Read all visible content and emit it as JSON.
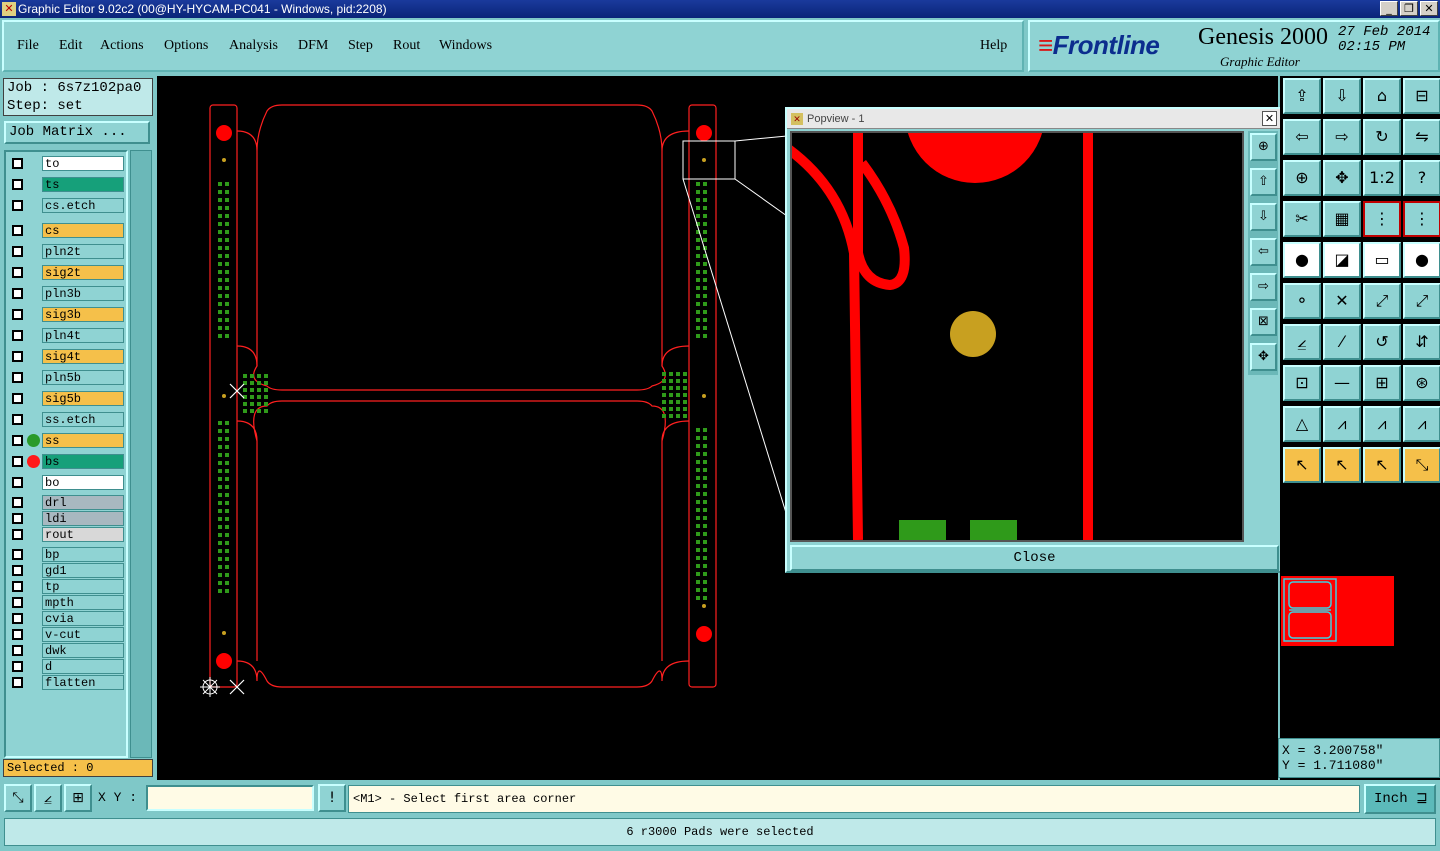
{
  "window": {
    "title": "Graphic Editor 9.02c2 (00@HY-HYCAM-PC041 - Windows, pid:2208)",
    "buttons": [
      "_",
      "❐",
      "✕"
    ]
  },
  "menu": {
    "items": [
      "File",
      "Edit",
      "Actions",
      "Options",
      "Analysis",
      "DFM",
      "Step",
      "Rout",
      "Windows"
    ],
    "help": "Help"
  },
  "brand": {
    "logo_text": "Frontline",
    "product": "Genesis 2000",
    "subtitle": "Graphic Editor",
    "date": "27 Feb 2014",
    "time": "02:15 PM"
  },
  "job": {
    "job_line": "Job : 6s7z102pa0",
    "step_line": "Step: set",
    "matrix_button": "Job Matrix ..."
  },
  "layers": [
    {
      "name": "to",
      "bg": "#ffffff",
      "dot": ""
    },
    {
      "name": "ts",
      "bg": "#16a07a",
      "dot": ""
    },
    {
      "name": "cs.etch",
      "bg": "#8fd3d3",
      "dot": ""
    },
    {
      "name": "cs",
      "bg": "#f5c04a",
      "dot": ""
    },
    {
      "name": "pln2t",
      "bg": "#8fd3d3",
      "dot": ""
    },
    {
      "name": "sig2t",
      "bg": "#f5c04a",
      "dot": ""
    },
    {
      "name": "pln3b",
      "bg": "#8fd3d3",
      "dot": ""
    },
    {
      "name": "sig3b",
      "bg": "#f5c04a",
      "dot": ""
    },
    {
      "name": "pln4t",
      "bg": "#8fd3d3",
      "dot": ""
    },
    {
      "name": "sig4t",
      "bg": "#f5c04a",
      "dot": ""
    },
    {
      "name": "pln5b",
      "bg": "#8fd3d3",
      "dot": ""
    },
    {
      "name": "sig5b",
      "bg": "#f5c04a",
      "dot": ""
    },
    {
      "name": "ss.etch",
      "bg": "#8fd3d3",
      "dot": ""
    },
    {
      "name": "ss",
      "bg": "#f5c04a",
      "dot": "#2a9a2a"
    },
    {
      "name": "bs",
      "bg": "#16a07a",
      "dot": "#ff1a1a"
    },
    {
      "name": "bo",
      "bg": "#ffffff",
      "dot": ""
    },
    {
      "name": "drl",
      "bg": "#a8b8c0",
      "dot": ""
    },
    {
      "name": "ldi",
      "bg": "#a8b8c0",
      "dot": ""
    },
    {
      "name": "rout",
      "bg": "#d8d8d8",
      "dot": ""
    },
    {
      "name": "bp",
      "bg": "#8fd3d3",
      "dot": ""
    },
    {
      "name": "gd1",
      "bg": "#8fd3d3",
      "dot": ""
    },
    {
      "name": "tp",
      "bg": "#8fd3d3",
      "dot": ""
    },
    {
      "name": "mpth",
      "bg": "#8fd3d3",
      "dot": ""
    },
    {
      "name": "cvia",
      "bg": "#8fd3d3",
      "dot": ""
    },
    {
      "name": "v-cut",
      "bg": "#8fd3d3",
      "dot": ""
    },
    {
      "name": "dwk",
      "bg": "#8fd3d3",
      "dot": ""
    },
    {
      "name": "d",
      "bg": "#8fd3d3",
      "dot": ""
    },
    {
      "name": "flatten",
      "bg": "#8fd3d3",
      "dot": ""
    }
  ],
  "selected": "Selected : 0",
  "popview": {
    "title": "Popview - 1",
    "close_label": "Close"
  },
  "coords": {
    "x": "X = 3.200758\"",
    "y": "Y = 1.711080\""
  },
  "bottom": {
    "xy_label": "X Y :",
    "xy_value": "",
    "prompt": "<M1> - Select first area corner",
    "unit": "Inch ⊒"
  },
  "status": "6 r3000 Pads were selected",
  "colors": {
    "board_outline": "#ff2020",
    "pad_red": "#ff0000",
    "pad_green": "#2f9a1a",
    "pad_gold": "#c8a020"
  }
}
